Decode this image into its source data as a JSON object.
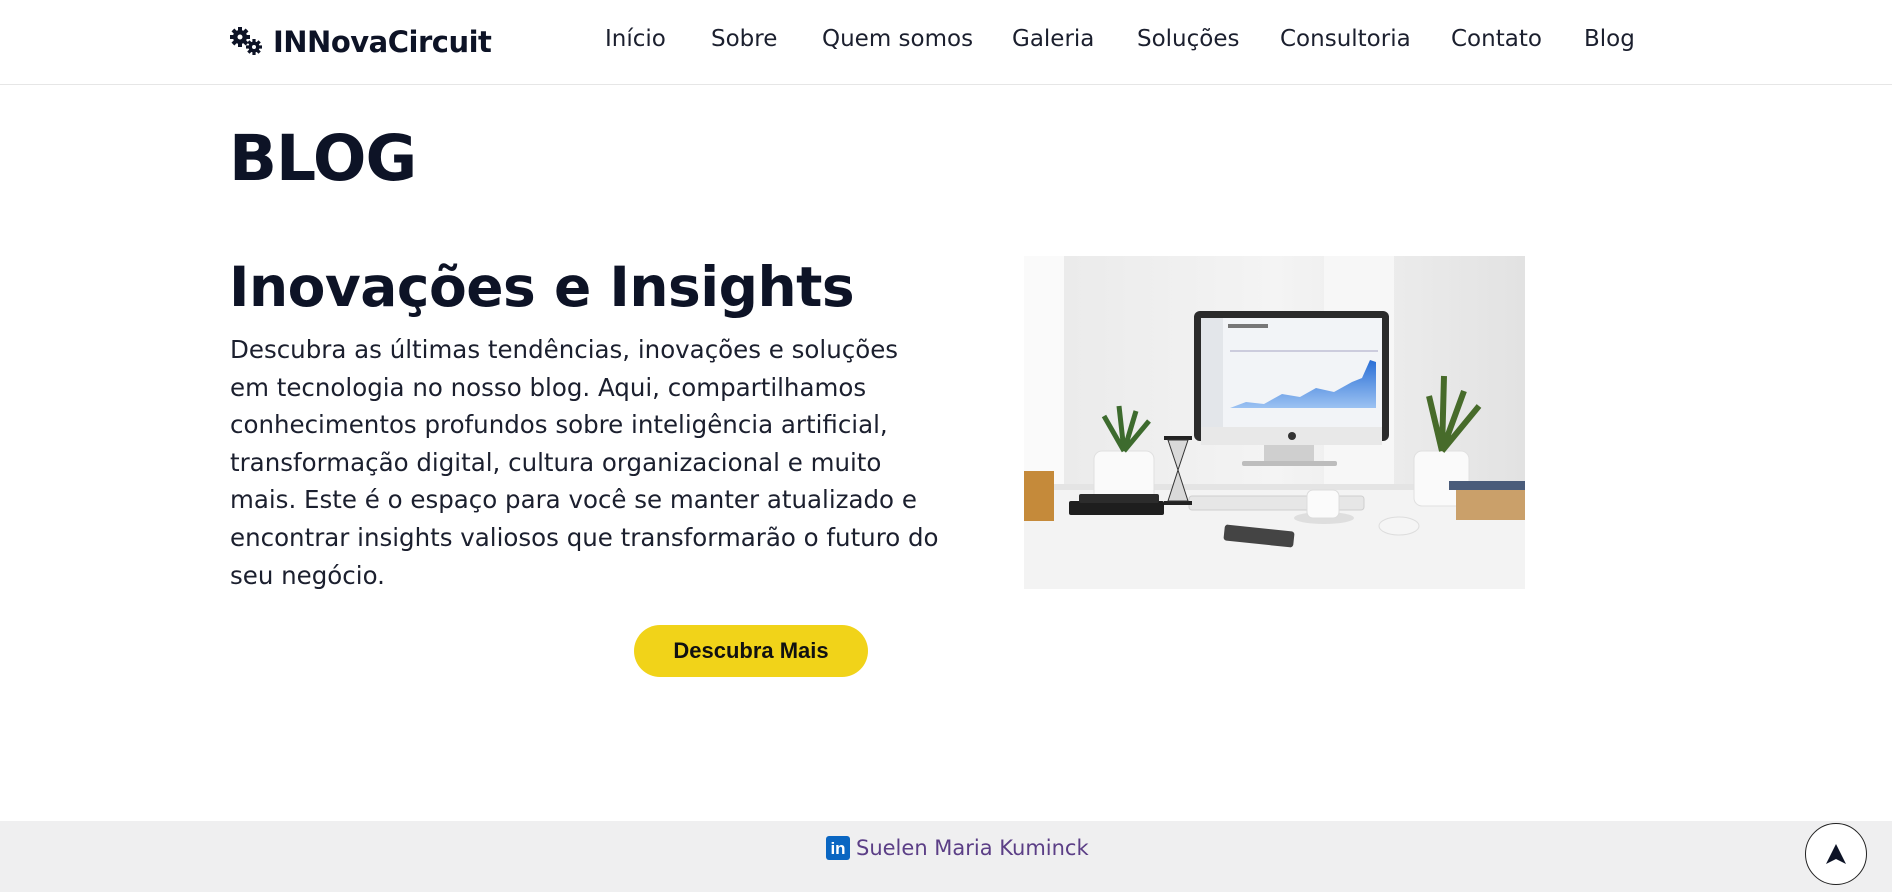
{
  "header": {
    "logo_text": "INNovaCircuit",
    "logo_icon": "gears-icon",
    "nav": [
      {
        "label": "Início"
      },
      {
        "label": "Sobre"
      },
      {
        "label": "Quem somos"
      },
      {
        "label": "Galeria"
      },
      {
        "label": "Soluções"
      },
      {
        "label": "Consultoria"
      },
      {
        "label": "Contato"
      },
      {
        "label": "Blog"
      }
    ]
  },
  "main": {
    "page_title": "BLOG",
    "section_title": "Inovações e Insights",
    "description": "Descubra as últimas tendências, inovações e soluções em tecnologia no nosso blog. Aqui, compartilhamos conhecimentos profundos sobre inteligência artificial, transformação digital, cultura organizacional e muito mais. Este é o espaço para você se manter atualizado e encontrar insights valiosos que transformarão o futuro do seu negócio.",
    "cta_label": "Descubra Mais",
    "accent_color": "#f1d319"
  },
  "footer": {
    "linkedin_icon_label": "in",
    "linkedin_name": "Suelen Maria Kuminck",
    "back_to_top_icon": "arrow-up-icon"
  }
}
